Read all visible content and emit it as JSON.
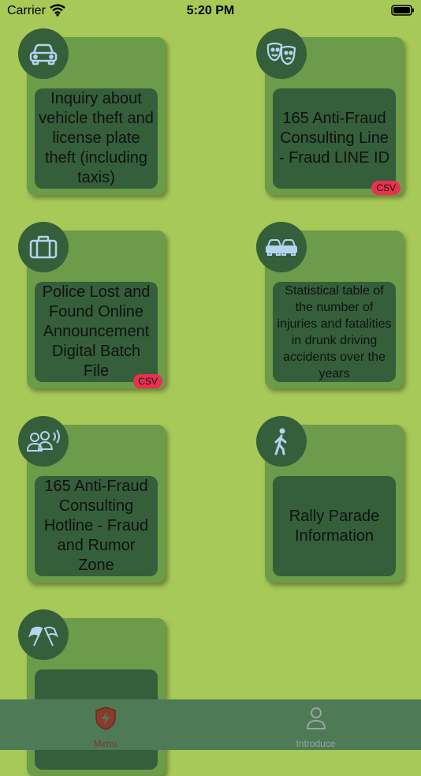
{
  "status_bar": {
    "carrier": "Carrier",
    "time": "5:20 PM"
  },
  "cards": [
    {
      "label": "Inquiry about vehicle theft and license plate theft (including taxis)",
      "icon": "car-icon",
      "csv": ""
    },
    {
      "label": "165 Anti-Fraud Consulting Line - Fraud LINE ID",
      "icon": "theater-masks-icon",
      "csv": "CSV"
    },
    {
      "label": "Police Lost and Found Online Announcement Digital Batch File",
      "icon": "briefcase-icon",
      "csv": "CSV"
    },
    {
      "label": "Statistical table of the number of injuries and fatalities in drunk driving accidents over the years",
      "icon": "cars-icon",
      "csv": ""
    },
    {
      "label": "165 Anti-Fraud Consulting Hotline - Fraud and Rumor Zone",
      "icon": "people-speaking-icon",
      "csv": ""
    },
    {
      "label": "Rally Parade Information",
      "icon": "walking-person-icon",
      "csv": ""
    },
    {
      "label": "",
      "icon": "flags-icon",
      "csv": ""
    }
  ],
  "tab_bar": {
    "tabs": [
      {
        "label": "Menu",
        "icon": "shield-bolt-icon",
        "selected": true
      },
      {
        "label": "Introduce",
        "icon": "person-icon",
        "selected": false
      }
    ]
  },
  "colors": {
    "background": "#a6c957",
    "card": "#6c9b4a",
    "card_inner": "#345f3a",
    "icon_stroke": "#b4d4f0",
    "csv_badge": "#e8304f",
    "tab_bar": "#4f7a56"
  }
}
